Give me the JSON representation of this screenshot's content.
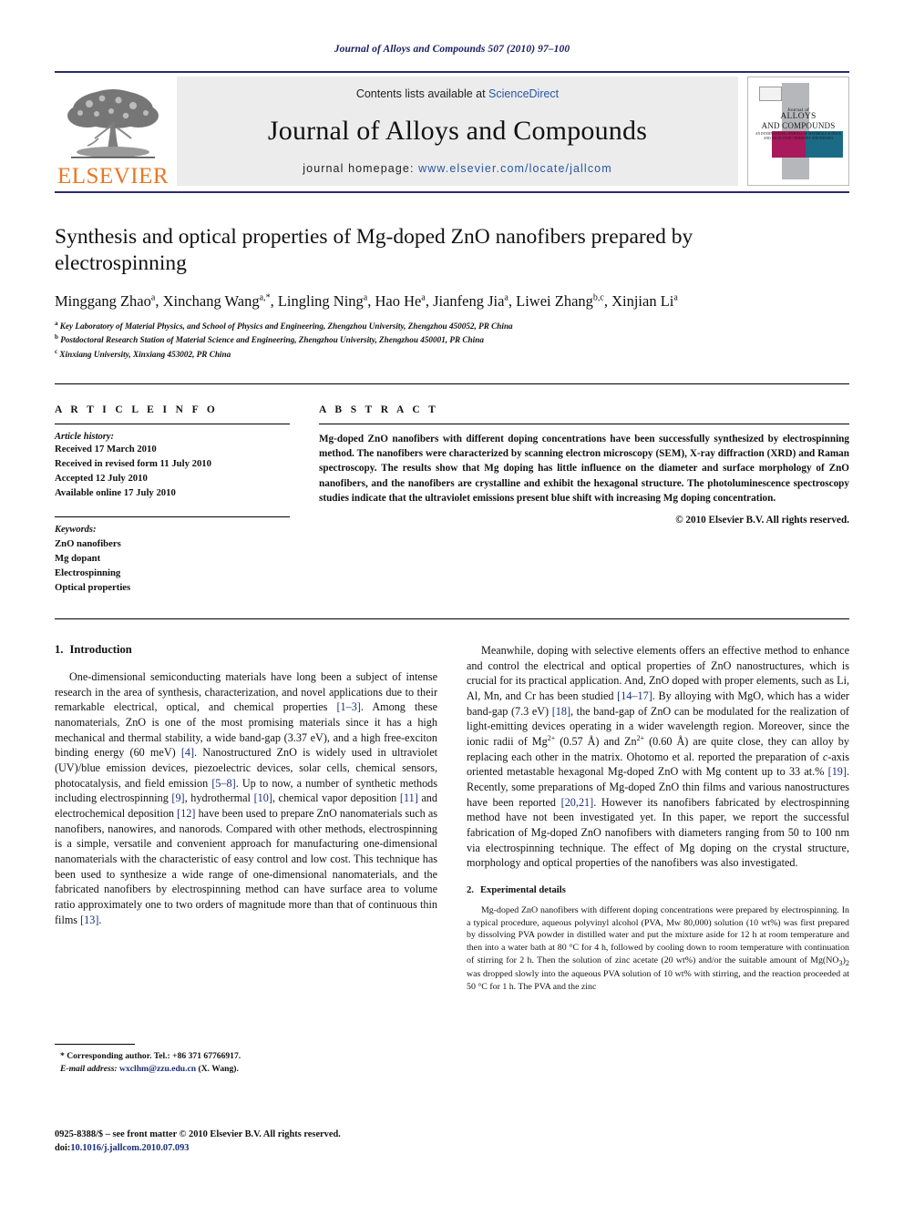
{
  "running_head": "Journal of Alloys and Compounds 507 (2010) 97–100",
  "masthead": {
    "contents_prefix": "Contents lists available at ",
    "sciencedirect": "ScienceDirect",
    "journal_title": "Journal of Alloys and Compounds",
    "homepage_prefix": "journal homepage: ",
    "homepage_url": "www.elsevier.com/locate/jallcom",
    "publisher_logo_text": "ELSEVIER",
    "cover": {
      "line1": "Journal of",
      "line2": "ALLOYS",
      "line3": "AND COMPOUNDS",
      "line4": "AN INTERNATIONAL JOURNAL OF MATERIALS SCIENCE AND SOLID STATE CHEMISTRY AND PHYSICS"
    },
    "accent_color": "#2b2b6b",
    "link_color": "#2956a3",
    "elsevier_orange": "#E87722",
    "cover_magenta": "#a81a5b",
    "cover_teal": "#1b6b86"
  },
  "title": "Synthesis and optical properties of Mg-doped ZnO nanofibers prepared by electrospinning",
  "authors_html": "Minggang Zhao<sup>a</sup>, Xinchang Wang<sup>a,*</sup>, Lingling Ning<sup>a</sup>, Hao He<sup>a</sup>, Jianfeng Jia<sup>a</sup>, Liwei Zhang<sup>b,c</sup>, Xinjian Li<sup>a</sup>",
  "affiliations": [
    {
      "marker": "a",
      "text": "Key Laboratory of Material Physics, and School of Physics and Engineering, Zhengzhou University, Zhengzhou 450052, PR China"
    },
    {
      "marker": "b",
      "text": "Postdoctoral Research Station of Material Science and Engineering, Zhengzhou University, Zhengzhou 450001, PR China"
    },
    {
      "marker": "c",
      "text": "Xinxiang University, Xinxiang 453002, PR China"
    }
  ],
  "article_info": {
    "heading": "A R T I C L E    I N F O",
    "history_label": "Article history:",
    "history": [
      "Received 17 March 2010",
      "Received in revised form 11 July 2010",
      "Accepted 12 July 2010",
      "Available online 17 July 2010"
    ],
    "keywords_label": "Keywords:",
    "keywords": [
      "ZnO nanofibers",
      "Mg dopant",
      "Electrospinning",
      "Optical properties"
    ]
  },
  "abstract": {
    "heading": "A B S T R A C T",
    "body": "Mg-doped ZnO nanofibers with different doping concentrations have been successfully synthesized by electrospinning method. The nanofibers were characterized by scanning electron microscopy (SEM), X-ray diffraction (XRD) and Raman spectroscopy. The results show that Mg doping has little influence on the diameter and surface morphology of ZnO nanofibers, and the nanofibers are crystalline and exhibit the hexagonal structure. The photoluminescence spectroscopy studies indicate that the ultraviolet emissions present blue shift with increasing Mg doping concentration.",
    "copyright": "© 2010 Elsevier B.V. All rights reserved."
  },
  "sections": {
    "introduction": {
      "number": "1.",
      "title": "Introduction",
      "paragraph_1_html": "One-dimensional semiconducting materials have long been a subject of intense research in the area of synthesis, characterization, and novel applications due to their remarkable electrical, optical, and chemical properties <span class=\"ref\">[1–3]</span>. Among these nanomaterials, ZnO is one of the most promising materials since it has a high mechanical and thermal stability, a wide band-gap (3.37 eV), and a high free-exciton binding energy (60 meV) <span class=\"ref\">[4]</span>. Nanostructured ZnO is widely used in ultraviolet (UV)/blue emission devices, piezoelectric devices, solar cells, chemical sensors, photocatalysis, and field emission <span class=\"ref\">[5–8]</span>. Up to now, a number of synthetic methods including electrospinning <span class=\"ref\">[9]</span>, hydrothermal <span class=\"ref\">[10]</span>, chemical vapor deposition <span class=\"ref\">[11]</span> and electrochemical deposition <span class=\"ref\">[12]</span> have been used to prepare ZnO nanomaterials such as nanofibers, nanowires, and nanorods. Compared with other methods, electrospinning is a simple, versatile and convenient approach for manufacturing one-dimensional nanomaterials with the characteristic of easy control and low cost. This technique has been used to synthesize a wide range of one-dimensional nanomaterials, and the fabricated nanofibers by electrospinning method can have surface area to volume ratio approximately one to two orders of magnitude more than that of continuous thin films <span class=\"ref\">[13]</span>.",
      "paragraph_2_html": "Meanwhile, doping with selective elements offers an effective method to enhance and control the electrical and optical properties of ZnO nanostructures, which is crucial for its practical application. And, ZnO doped with proper elements, such as Li, Al, Mn, and Cr has been studied <span class=\"ref\">[14–17]</span>. By alloying with MgO, which has a wider band-gap (7.3 eV) <span class=\"ref\">[18]</span>, the band-gap of ZnO can be modulated for the realization of light-emitting devices operating in a wider wavelength region. Moreover, since the ionic radii of Mg<sup class=\"s\">2+</sup> (0.57 Å) and Zn<sup class=\"s\">2+</sup> (0.60 Å) are quite close, they can alloy by replacing each other in the matrix. Ohotomo et al. reported the preparation of <i>c</i>-axis oriented metastable hexagonal Mg-doped ZnO with Mg content up to 33 at.% <span class=\"ref\">[19]</span>. Recently, some preparations of Mg-doped ZnO thin films and various nanostructures have been reported <span class=\"ref\">[20,21]</span>. However its nanofibers fabricated by electrospinning method have not been investigated yet. In this paper, we report the successful fabrication of Mg-doped ZnO nanofibers with diameters ranging from 50 to 100 nm via electrospinning technique. The effect of Mg doping on the crystal structure, morphology and optical properties of the nanofibers was also investigated."
    },
    "experimental": {
      "number": "2.",
      "title": "Experimental details",
      "paragraph_1_html": "Mg-doped ZnO nanofibers with different doping concentrations were prepared by electrospinning. In a typical procedure, aqueous polyvinyl alcohol (PVA, Mw 80,000) solution (10 wt%) was first prepared by dissolving PVA powder in distilled water and put the mixture aside for 12 h at room temperature and then into a water bath at 80 °C for 4 h, followed by cooling down to room temperature with continuation of stirring for 2 h. Then the solution of zinc acetate (20 wt%) and/or the suitable amount of Mg(NO<sub>3</sub>)<sub>2</sub> was dropped slowly into the aqueous PVA solution of 10 wt% with stirring, and the reaction proceeded at 50 °C for 1 h. The PVA and the zinc"
    }
  },
  "footnote": {
    "corresponding_html": "* Corresponding author. Tel.: +86 371 67766917.",
    "email_label": "E-mail address:",
    "email": "wxclhm@zzu.edu.cn",
    "email_suffix": "(X. Wang)."
  },
  "bottom_matter": {
    "front_matter": "0925-8388/$ – see front matter © 2010 Elsevier B.V. All rights reserved.",
    "doi_label": "doi:",
    "doi": "10.1016/j.jallcom.2010.07.093"
  }
}
